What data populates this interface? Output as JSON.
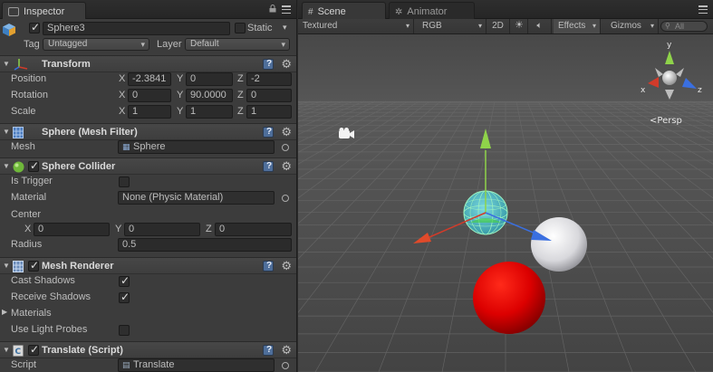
{
  "inspector": {
    "tab_label": "Inspector",
    "object": {
      "name": "Sphere3",
      "active": true,
      "static_label": "Static",
      "static_checked": false,
      "tag_label": "Tag",
      "tag_value": "Untagged",
      "layer_label": "Layer",
      "layer_value": "Default"
    },
    "transform": {
      "title": "Transform",
      "position_label": "Position",
      "rotation_label": "Rotation",
      "scale_label": "Scale",
      "axis_x": "X",
      "axis_y": "Y",
      "axis_z": "Z",
      "position": {
        "x": "-2.3841",
        "y": "0",
        "z": "-2"
      },
      "rotation": {
        "x": "0",
        "y": "90.0000",
        "z": "0"
      },
      "scale": {
        "x": "1",
        "y": "1",
        "z": "1"
      }
    },
    "mesh_filter": {
      "title": "Sphere (Mesh Filter)",
      "mesh_label": "Mesh",
      "mesh_value": "Sphere"
    },
    "sphere_collider": {
      "title": "Sphere Collider",
      "enabled": true,
      "is_trigger_label": "Is Trigger",
      "is_trigger": false,
      "material_label": "Material",
      "material_value": "None (Physic Material)",
      "center_label": "Center",
      "center": {
        "x": "0",
        "y": "0",
        "z": "0"
      },
      "radius_label": "Radius",
      "radius_value": "0.5"
    },
    "mesh_renderer": {
      "title": "Mesh Renderer",
      "enabled": true,
      "cast_shadows_label": "Cast Shadows",
      "cast_shadows": true,
      "receive_shadows_label": "Receive Shadows",
      "receive_shadows": true,
      "materials_label": "Materials",
      "use_light_probes_label": "Use Light Probes",
      "use_light_probes": false
    },
    "translate_script": {
      "title": "Translate (Script)",
      "enabled": true,
      "script_label": "Script",
      "script_value": "Translate"
    }
  },
  "scene": {
    "tab_scene": "Scene",
    "tab_animator": "Animator",
    "toolbar": {
      "shading_mode": "Textured",
      "render_mode": "RGB",
      "view_2d": "2D",
      "effects": "Effects",
      "gizmos": "Gizmos",
      "search_placeholder": "All"
    },
    "gizmo": {
      "y_label": "y",
      "x_label": "x",
      "z_label": "z",
      "projection_label": "Persp"
    }
  },
  "colors": {
    "axis_x": "#d23b2a",
    "axis_y": "#8fd34a",
    "axis_z": "#3a6fe0",
    "red_sphere": "#e00000",
    "white_sphere": "#e8e8ec",
    "collider_sphere": "#3fd0e0"
  }
}
